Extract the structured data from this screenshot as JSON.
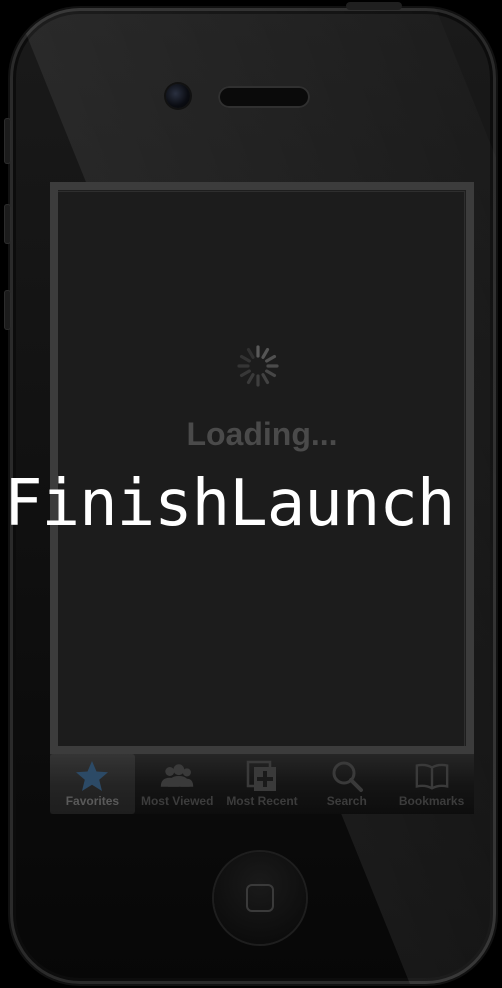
{
  "device": {
    "model": "iPhone"
  },
  "screen": {
    "loading_label": "Loading...",
    "tabs": [
      {
        "label": "Favorites",
        "icon": "star-icon",
        "active": true
      },
      {
        "label": "Most Viewed",
        "icon": "people-icon",
        "active": false
      },
      {
        "label": "Most Recent",
        "icon": "recent-icon",
        "active": false
      },
      {
        "label": "Search",
        "icon": "search-icon",
        "active": false
      },
      {
        "label": "Bookmarks",
        "icon": "book-icon",
        "active": false
      }
    ]
  },
  "overlay": {
    "text": "FinishLaunch"
  },
  "colors": {
    "star_active": "#2c4a66",
    "tab_icon_inactive": "#3a3a3a",
    "loading_text": "#4a4a4a"
  }
}
